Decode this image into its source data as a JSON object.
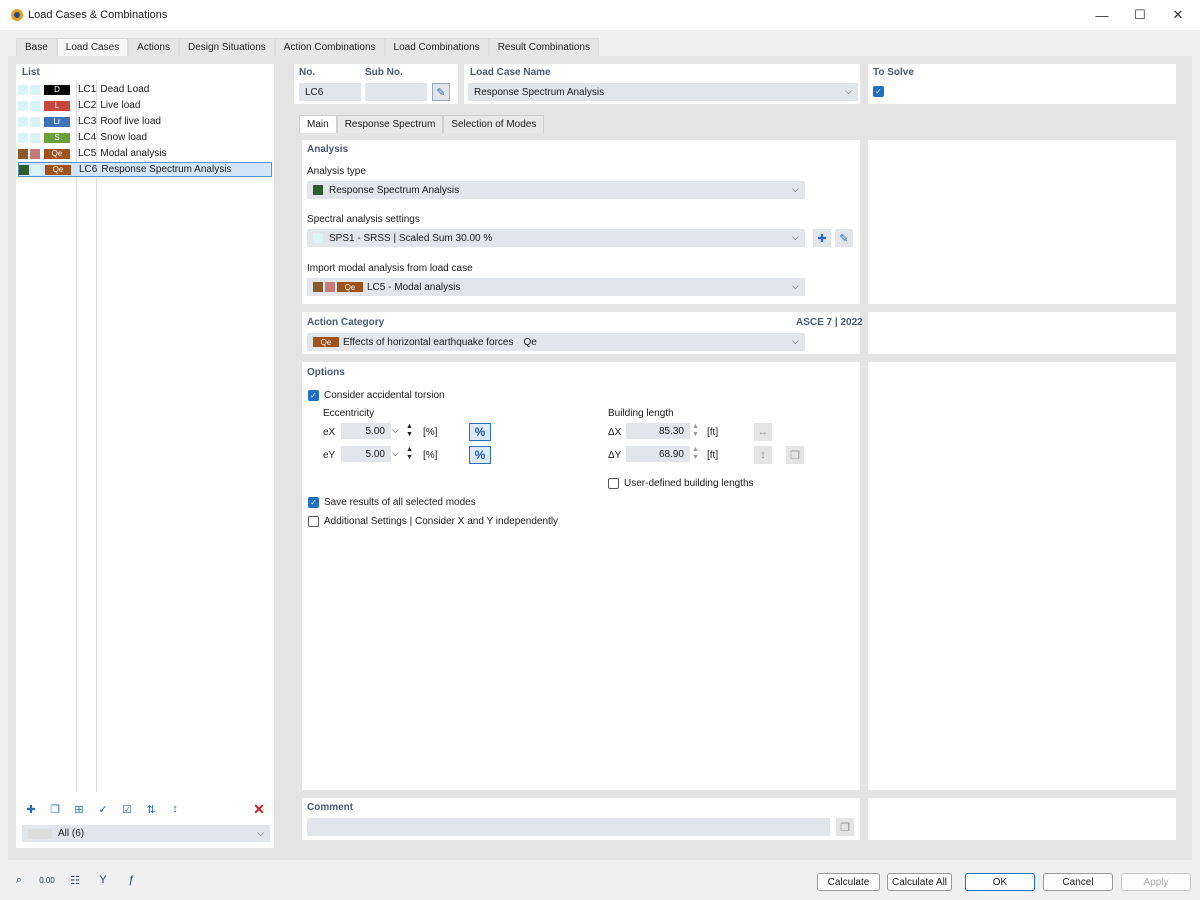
{
  "window": {
    "title": "Load Cases & Combinations",
    "min": "—",
    "max": "☐",
    "close": "✕"
  },
  "tabs": [
    "Base",
    "Load Cases",
    "Actions",
    "Design Situations",
    "Action Combinations",
    "Load Combinations",
    "Result Combinations"
  ],
  "list": {
    "label": "List",
    "items": [
      {
        "badge": "D",
        "badge_color": "#000000",
        "sw1": "#d9f3f7",
        "sw2": "#d9f3f7",
        "id": "LC1",
        "name": "Dead Load"
      },
      {
        "badge": "L",
        "badge_color": "#c8463c",
        "sw1": "#d9f3f7",
        "sw2": "#d9f3f7",
        "id": "LC2",
        "name": "Live load"
      },
      {
        "badge": "Lr",
        "badge_color": "#3f72b8",
        "sw1": "#d9f3f7",
        "sw2": "#d9f3f7",
        "id": "LC3",
        "name": "Roof live load"
      },
      {
        "badge": "S",
        "badge_color": "#6aa03a",
        "sw1": "#d9f3f7",
        "sw2": "#d9f3f7",
        "id": "LC4",
        "name": "Snow load"
      },
      {
        "badge": "Qe",
        "badge_color": "#a0521d",
        "sw1": "#8a5a2b",
        "sw2": "#c27a7a",
        "id": "LC5",
        "name": "Modal analysis"
      },
      {
        "badge": "Qe",
        "badge_color": "#a0521d",
        "sw1": "#2e5d2e",
        "sw2": "#d9f3f7",
        "id": "LC6",
        "name": "Response Spectrum Analysis"
      }
    ],
    "filter": "All (6)"
  },
  "header": {
    "no_label": "No.",
    "no_value": "LC6",
    "subno_label": "Sub No.",
    "name_label": "Load Case Name",
    "name_value": "Response Spectrum Analysis",
    "solve_label": "To Solve"
  },
  "subtabs": [
    "Main",
    "Response Spectrum",
    "Selection of Modes"
  ],
  "analysis": {
    "label": "Analysis",
    "type_label": "Analysis type",
    "type_value": "Response Spectrum Analysis",
    "spectral_label": "Spectral analysis settings",
    "spectral_value": "SPS1 - SRSS | Scaled Sum 30.00 %",
    "import_label": "Import modal analysis from load case",
    "import_badge": "Qe",
    "import_value": "LC5 - Modal analysis"
  },
  "action_category": {
    "label": "Action Category",
    "standard": "ASCE 7 | 2022",
    "badge": "Qe",
    "value": "Effects of horizontal earthquake forces",
    "suffix": "Qe"
  },
  "options": {
    "label": "Options",
    "accidental": "Consider accidental torsion",
    "eccentricity_label": "Eccentricity",
    "ex_label": "eX",
    "ex_value": "5.00",
    "ex_unit": "[%]",
    "ey_label": "eY",
    "ey_value": "5.00",
    "ey_unit": "[%]",
    "pct": "%",
    "building_label": "Building length",
    "dx_label": "ΔX",
    "dx_value": "85.30",
    "dx_unit": "[ft]",
    "dy_label": "ΔY",
    "dy_value": "68.90",
    "dy_unit": "[ft]",
    "user_defined": "User-defined building lengths",
    "save_results": "Save results of all selected modes",
    "additional": "Additional Settings | Consider X and Y independently"
  },
  "comment": {
    "label": "Comment"
  },
  "footer": {
    "calculate": "Calculate",
    "calculate_all": "Calculate All",
    "ok": "OK",
    "cancel": "Cancel",
    "apply": "Apply"
  }
}
